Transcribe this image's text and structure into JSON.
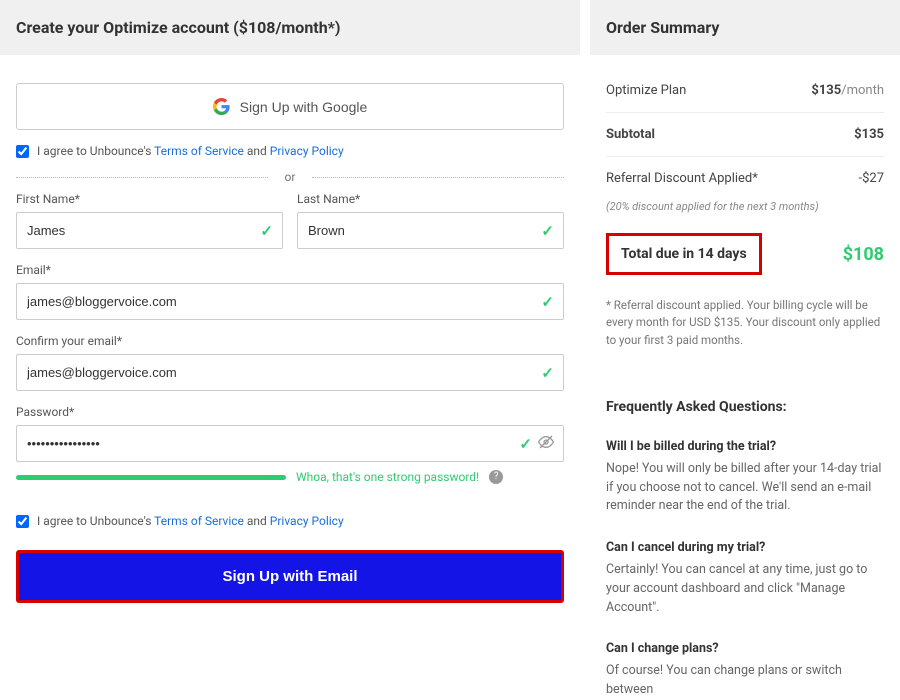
{
  "header": {
    "title": "Create your Optimize account ($108/month*)"
  },
  "google": {
    "label": "Sign Up with Google"
  },
  "consent": {
    "prefix": "I agree to Unbounce's ",
    "tos": "Terms of Service",
    "mid": " and ",
    "privacy": "Privacy Policy"
  },
  "divider": "or",
  "form": {
    "first_name": {
      "label": "First Name*",
      "value": "James"
    },
    "last_name": {
      "label": "Last Name*",
      "value": "Brown"
    },
    "email": {
      "label": "Email*",
      "value": "james@bloggervoice.com"
    },
    "confirm_email": {
      "label": "Confirm your email*",
      "value": "james@bloggervoice.com"
    },
    "password": {
      "label": "Password*",
      "value": "••••••••••••••••"
    },
    "strength_text": "Whoa, that's one strong password!"
  },
  "signup_btn": "Sign Up with Email",
  "order": {
    "header": "Order Summary",
    "plan": {
      "label": "Optimize Plan",
      "price": "$135",
      "per": "/month"
    },
    "subtotal": {
      "label": "Subtotal",
      "value": "$135"
    },
    "discount": {
      "label": "Referral Discount Applied*",
      "value": "-$27"
    },
    "discount_note": "(20% discount applied for the next 3 months)",
    "total": {
      "label": "Total due in 14 days",
      "value": "$108"
    },
    "disclaimer": "* Referral discount applied. Your billing cycle will be every month for USD $135. Your discount only applied to your first 3 paid months."
  },
  "faq": {
    "title": "Frequently Asked Questions:",
    "items": [
      {
        "q": "Will I be billed during the trial?",
        "a": "Nope! You will only be billed after your 14-day trial if you choose not to cancel. We'll send an e-mail reminder near the end of the trial."
      },
      {
        "q": "Can I cancel during my trial?",
        "a": "Certainly! You can cancel at any time, just go to your account dashboard and click \"Manage Account\"."
      },
      {
        "q": "Can I change plans?",
        "a": "Of course! You can change plans or switch between"
      }
    ]
  }
}
